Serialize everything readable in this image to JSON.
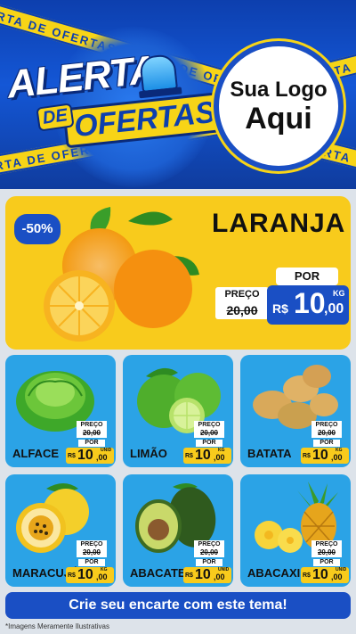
{
  "header": {
    "tape_text": "ALERTA DE OFERTAS ALERTA DE OFERTAS",
    "tape_side_text": "OFERTA",
    "title_line1": "ALERTA",
    "title_de": "DE",
    "title_line2": "OFERTAS",
    "logo_line1": "Sua Logo",
    "logo_line2": "Aqui"
  },
  "featured": {
    "discount": "-50%",
    "name": "LARANJA",
    "por_label": "POR",
    "preco_label": "PREÇO",
    "old_price": "20,00",
    "currency": "R$",
    "price_int": "10",
    "price_dec": ",00",
    "unit": "KG"
  },
  "products": [
    {
      "name": "ALFACE",
      "preco_label": "PREÇO",
      "old_price": "20,00",
      "por_label": "POR",
      "currency": "R$",
      "price_int": "10",
      "price_dec": ",00",
      "unit": "UNID"
    },
    {
      "name": "LIMÃO",
      "preco_label": "PREÇO",
      "old_price": "20,00",
      "por_label": "POR",
      "currency": "R$",
      "price_int": "10",
      "price_dec": ",00",
      "unit": "KG"
    },
    {
      "name": "BATATA",
      "preco_label": "PREÇO",
      "old_price": "20,00",
      "por_label": "POR",
      "currency": "R$",
      "price_int": "10",
      "price_dec": ",00",
      "unit": "KG"
    },
    {
      "name": "MARACUJÁ",
      "preco_label": "PREÇO",
      "old_price": "20,00",
      "por_label": "POR",
      "currency": "R$",
      "price_int": "10",
      "price_dec": ",00",
      "unit": "KG"
    },
    {
      "name": "ABACATE",
      "preco_label": "PREÇO",
      "old_price": "20,00",
      "por_label": "POR",
      "currency": "R$",
      "price_int": "10",
      "price_dec": ",00",
      "unit": "UNID"
    },
    {
      "name": "ABACAXI",
      "preco_label": "PREÇO",
      "old_price": "20,00",
      "por_label": "POR",
      "currency": "R$",
      "price_int": "10",
      "price_dec": ",00",
      "unit": "UNID"
    }
  ],
  "footer": {
    "cta": "Crie seu encarte com este tema!",
    "disclaimer": "*Imagens Meramente Ilustrativas"
  },
  "colors": {
    "brand_blue": "#1a4fc4",
    "brand_yellow": "#f8cb1c",
    "card_blue": "#2ba3e6"
  }
}
